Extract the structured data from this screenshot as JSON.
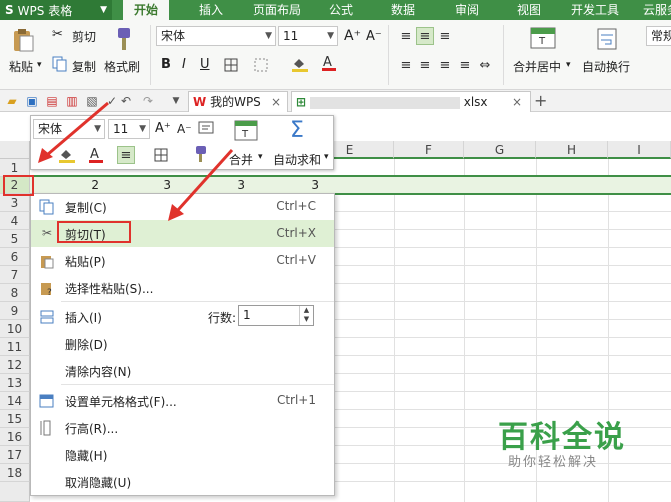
{
  "app": {
    "name": "WPS 表格",
    "logo": "S"
  },
  "menu_tabs": [
    "开始",
    "插入",
    "页面布局",
    "公式",
    "数据",
    "审阅",
    "视图",
    "开发工具",
    "云服务"
  ],
  "ribbon": {
    "paste": "粘贴",
    "cut": "剪切",
    "copy": "复制",
    "format_painter": "格式刷",
    "font_name": "宋体",
    "font_size": "11",
    "bold": "B",
    "italic": "I",
    "underline": "U",
    "font_grow": "A⁺",
    "font_shrink": "A⁻",
    "merge_center": "合并居中",
    "wrap_text": "自动换行",
    "number_format": "常规"
  },
  "quickbar": {
    "tab1": "我的WPS",
    "tab2": "xlsx"
  },
  "mini_toolbar": {
    "font_name": "宋体",
    "font_size": "11",
    "merge": "合并",
    "autosum": "自动求和"
  },
  "columns": [
    "E",
    "F",
    "G",
    "H",
    "I"
  ],
  "rows": [
    "1",
    "2",
    "3",
    "4",
    "5",
    "6",
    "7",
    "8",
    "9",
    "10",
    "11",
    "12",
    "13",
    "14",
    "15",
    "16",
    "17",
    "18"
  ],
  "row2_values": [
    "2",
    "3",
    "3",
    "3"
  ],
  "context_menu": [
    {
      "icon": "copy-icon",
      "label": "复制(C)",
      "shortcut": "Ctrl+C"
    },
    {
      "icon": "cut-icon",
      "label": "剪切(T)",
      "shortcut": "Ctrl+X"
    },
    {
      "icon": "paste-icon",
      "label": "粘贴(P)",
      "shortcut": "Ctrl+V"
    },
    {
      "icon": "paste-special-icon",
      "label": "选择性粘贴(S)...",
      "shortcut": ""
    },
    {
      "icon": "insert-icon",
      "label": "插入(I)",
      "shortcut": ""
    },
    {
      "icon": "",
      "label": "删除(D)",
      "shortcut": ""
    },
    {
      "icon": "",
      "label": "清除内容(N)",
      "shortcut": ""
    },
    {
      "icon": "format-cells-icon",
      "label": "设置单元格格式(F)...",
      "shortcut": "Ctrl+1"
    },
    {
      "icon": "row-height-icon",
      "label": "行高(R)...",
      "shortcut": ""
    },
    {
      "icon": "",
      "label": "隐藏(H)",
      "shortcut": ""
    },
    {
      "icon": "",
      "label": "取消隐藏(U)",
      "shortcut": ""
    }
  ],
  "insert_rows": {
    "label": "行数:",
    "value": "1"
  },
  "watermark": {
    "title": "百科全说",
    "subtitle": "助你轻松解决"
  },
  "colors": {
    "brand_green": "#3f8f46",
    "highlight": "#dff0d4",
    "annotation_red": "#e0322c"
  }
}
